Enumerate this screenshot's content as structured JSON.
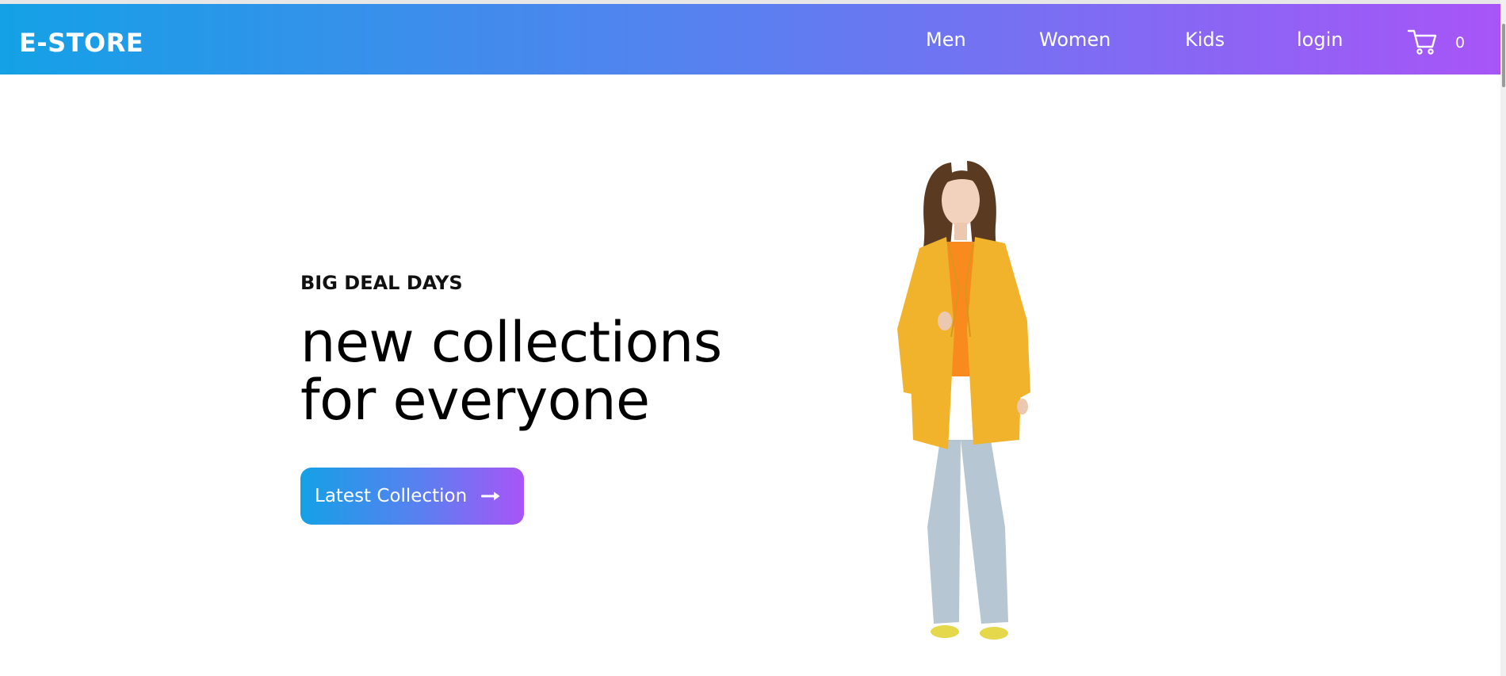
{
  "brand": {
    "logo_text": "E-STORE",
    "gradient_start": "#14a1e6",
    "gradient_mid": "#5b7ff0",
    "gradient_end": "#a855f7"
  },
  "nav": {
    "links": [
      {
        "label": "Men",
        "icon": null
      },
      {
        "label": "Women",
        "icon": null
      },
      {
        "label": "Kids",
        "icon": null
      },
      {
        "label": "login",
        "icon": null
      }
    ],
    "cart": {
      "icon": "shopping-cart-icon",
      "count": "0"
    }
  },
  "hero": {
    "eyebrow": "BIG DEAL DAYS",
    "headline_line1": "new collections",
    "headline_line2": "for everyone",
    "cta_label": "Latest Collection",
    "cta_icon": "arrow-right-icon"
  },
  "colors": {
    "jacket": "#f2b32c",
    "top": "#f98a1e",
    "jeans": "#b7c6d3",
    "hair": "#5b3a22"
  }
}
